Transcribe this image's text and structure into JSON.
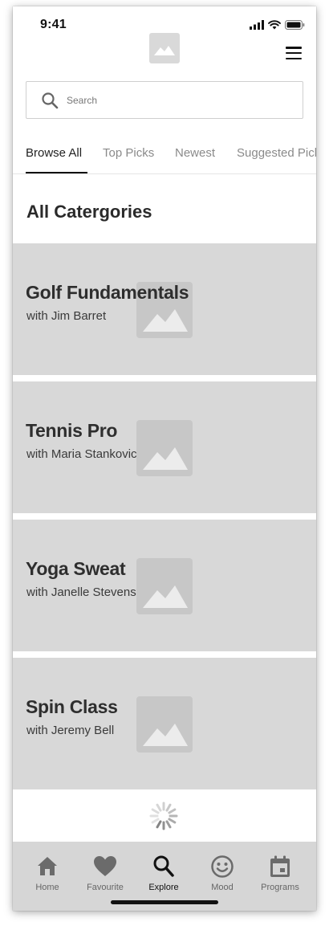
{
  "status_bar": {
    "time": "9:41",
    "icons": [
      "signal-icon",
      "wifi-icon",
      "battery-icon"
    ]
  },
  "header": {
    "logo_icon": "image-placeholder-icon",
    "menu_icon": "hamburger-menu-icon"
  },
  "search": {
    "placeholder": "Search",
    "icon": "search-icon"
  },
  "tabs": [
    {
      "label": "Browse All",
      "active": true
    },
    {
      "label": "Top Picks",
      "active": false
    },
    {
      "label": "Newest",
      "active": false
    },
    {
      "label": "Suggested Picks",
      "active": false
    }
  ],
  "section": {
    "title": "All Catergories"
  },
  "cards": [
    {
      "title": "Golf Fundamentals",
      "subtitle": "with Jim Barret"
    },
    {
      "title": "Tennis Pro",
      "subtitle": "with Maria Stankovic"
    },
    {
      "title": "Yoga Sweat",
      "subtitle": "with Janelle Stevens"
    },
    {
      "title": "Spin Class",
      "subtitle": "with Jeremy Bell"
    }
  ],
  "loading": {
    "icon": "loading-spinner-icon"
  },
  "tab_bar": {
    "items": [
      {
        "label": "Home",
        "icon": "home-icon",
        "active": false
      },
      {
        "label": "Favourite",
        "icon": "heart-icon",
        "active": false
      },
      {
        "label": "Explore",
        "icon": "search-icon",
        "active": true
      },
      {
        "label": "Mood",
        "icon": "smiley-icon",
        "active": false
      },
      {
        "label": "Programs",
        "icon": "calendar-icon",
        "active": false
      }
    ]
  },
  "colors": {
    "card_background": "#d8d8d8",
    "placeholder_image": "#c7c7c7",
    "tab_bar_background": "#d6d6d6",
    "active_text": "#111111",
    "inactive_text": "#8a8a8a"
  }
}
